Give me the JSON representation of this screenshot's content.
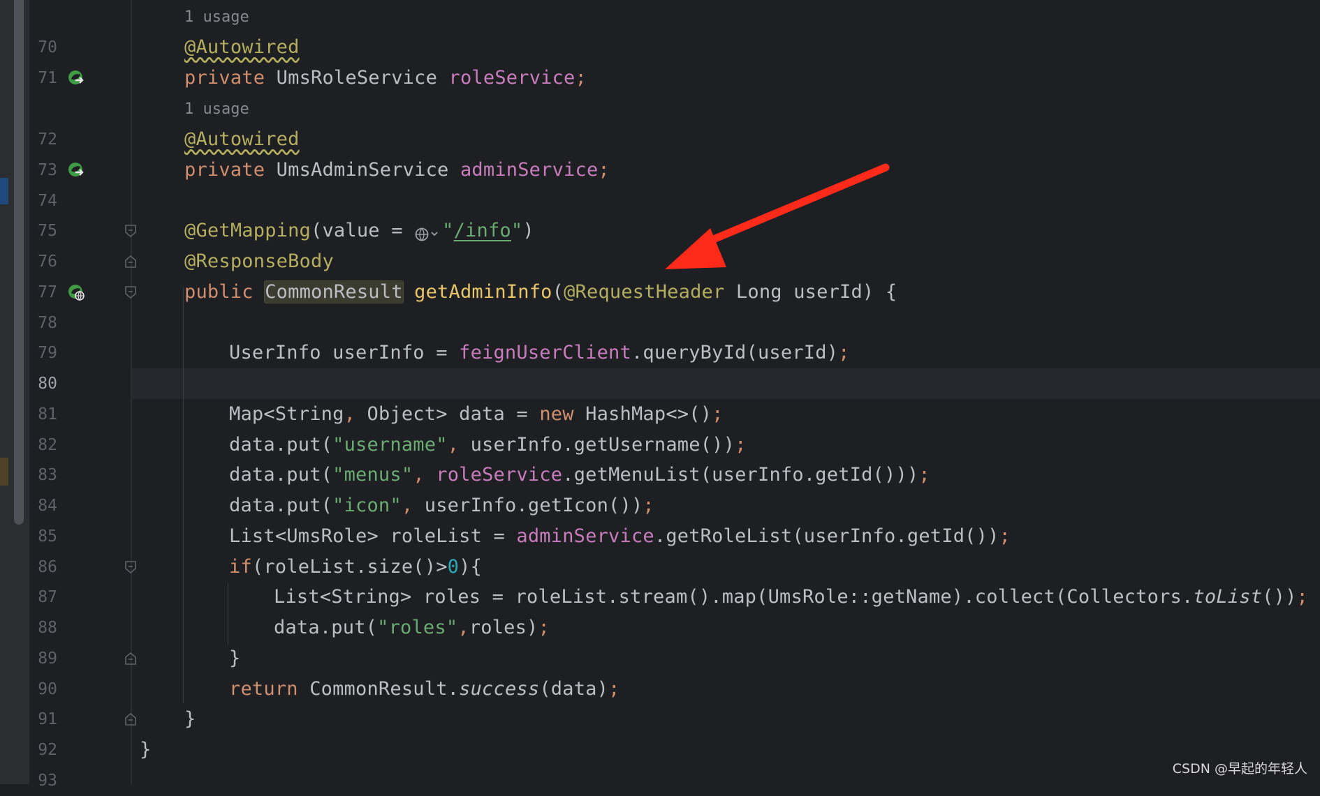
{
  "hints": {
    "usage_1": "1 usage",
    "usage_2": "1 usage"
  },
  "lines": [
    {
      "n": "70",
      "parts": {
        "a": "@Autowired"
      }
    },
    {
      "n": "71",
      "parts": {
        "a": "private",
        "b": " UmsRoleService ",
        "c": "roleService",
        "d": ";"
      }
    },
    {
      "n": "72",
      "parts": {
        "a": "@Autowired"
      }
    },
    {
      "n": "73",
      "parts": {
        "a": "private",
        "b": " UmsAdminService ",
        "c": "adminService",
        "d": ";"
      }
    },
    {
      "n": "74",
      "parts": {}
    },
    {
      "n": "75",
      "parts": {
        "a": "@GetMapping",
        "b": "(value = ",
        "c": "\"",
        "d": "/info",
        "e": "\"",
        "f": ")"
      }
    },
    {
      "n": "76",
      "parts": {
        "a": "@ResponseBody"
      }
    },
    {
      "n": "77",
      "parts": {
        "a": "public",
        "b": " ",
        "c": "CommonResult",
        "d": " ",
        "e": "getAdminInfo",
        "f": "(",
        "g": "@RequestHeader",
        "h": " Long userId) {"
      }
    },
    {
      "n": "78",
      "parts": {}
    },
    {
      "n": "79",
      "parts": {
        "a": "UserInfo userInfo = ",
        "b": "feignUserClient",
        "c": ".queryById(userId)",
        "d": ";"
      }
    },
    {
      "n": "80",
      "parts": {}
    },
    {
      "n": "81",
      "parts": {
        "a": "Map<String",
        "b": ",",
        "c": " Object> data = ",
        "d": "new",
        "e": " HashMap<>()",
        "f": ";"
      }
    },
    {
      "n": "82",
      "parts": {
        "a": "data.put(",
        "b": "\"username\"",
        "c": ",",
        "d": " userInfo.getUsername())",
        "e": ";"
      }
    },
    {
      "n": "83",
      "parts": {
        "a": "data.put(",
        "b": "\"menus\"",
        "c": ",",
        "d": " ",
        "e": "roleService",
        "f": ".getMenuList(userInfo.getId()))",
        "g": ";"
      }
    },
    {
      "n": "84",
      "parts": {
        "a": "data.put(",
        "b": "\"icon\"",
        "c": ",",
        "d": " userInfo.getIcon())",
        "e": ";"
      }
    },
    {
      "n": "85",
      "parts": {
        "a": "List<UmsRole> roleList = ",
        "b": "adminService",
        "c": ".getRoleList(userInfo.getId())",
        "d": ";"
      }
    },
    {
      "n": "86",
      "parts": {
        "a": "if",
        "b": "(roleList.size()>",
        "c": "0",
        "d": "){"
      }
    },
    {
      "n": "87",
      "parts": {
        "a": "List<String> roles = roleList.stream().map(UmsRole::getName).collect(Collectors.",
        "b": "toList",
        "c": "())",
        "d": ";"
      }
    },
    {
      "n": "88",
      "parts": {
        "a": "data.put(",
        "b": "\"roles\"",
        "c": ",",
        "d": "roles)",
        "e": ";"
      }
    },
    {
      "n": "89",
      "parts": {
        "a": "}"
      }
    },
    {
      "n": "90",
      "parts": {
        "a": "return",
        "b": " CommonResult.",
        "c": "success",
        "d": "(data)",
        "e": ";"
      }
    },
    {
      "n": "91",
      "parts": {
        "a": "}"
      }
    },
    {
      "n": "92",
      "parts": {
        "a": "}"
      }
    },
    {
      "n": "93",
      "parts": {}
    }
  ],
  "watermark": "CSDN @早起的年轻人",
  "icons": {
    "bean": "spring-bean-injection-icon",
    "web": "spring-web-endpoint-icon",
    "globe": "globe-endpoint-icon",
    "fold": "fold-marker-icon",
    "arrow": "red-annotation-arrow"
  },
  "colors": {
    "background": "#1e1f22",
    "keyword": "#cf8e6d",
    "annotation": "#b3ae60",
    "field": "#c77dbb",
    "string": "#6aab73",
    "number": "#2aacb8",
    "arrow": "#ff2a1a",
    "spring_green": "#3f9b45"
  }
}
